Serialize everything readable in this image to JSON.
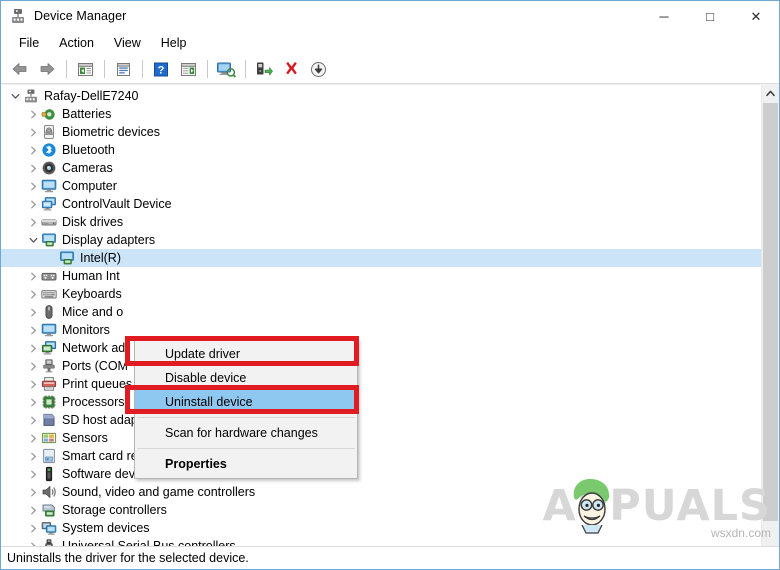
{
  "window": {
    "title": "Device Manager",
    "icon": "device-manager-icon",
    "buttons": {
      "minimize": "─",
      "maximize": "□",
      "close": "✕"
    }
  },
  "menubar": {
    "items": [
      {
        "label": "File",
        "name": "menu-file"
      },
      {
        "label": "Action",
        "name": "menu-action"
      },
      {
        "label": "View",
        "name": "menu-view"
      },
      {
        "label": "Help",
        "name": "menu-help"
      }
    ]
  },
  "toolbar": {
    "buttons": [
      {
        "name": "back-icon",
        "title": "Back"
      },
      {
        "name": "forward-icon",
        "title": "Forward"
      },
      {
        "name": "separator-1",
        "title": ""
      },
      {
        "name": "show-hide-console-tree-icon",
        "title": "Show/Hide Console Tree"
      },
      {
        "name": "separator-2",
        "title": ""
      },
      {
        "name": "properties-icon",
        "title": "Properties"
      },
      {
        "name": "separator-3",
        "title": ""
      },
      {
        "name": "help-icon",
        "title": "Help"
      },
      {
        "name": "show-hide-action-pane-icon",
        "title": "Show/Hide Action Pane"
      },
      {
        "name": "separator-4",
        "title": ""
      },
      {
        "name": "scan-for-hardware-changes-icon",
        "title": "Scan for hardware changes"
      },
      {
        "name": "separator-5",
        "title": ""
      },
      {
        "name": "update-driver-icon",
        "title": "Update driver"
      },
      {
        "name": "uninstall-device-icon",
        "title": "Uninstall device"
      },
      {
        "name": "disable-device-icon",
        "title": "Disable device"
      }
    ]
  },
  "tree": {
    "root": {
      "label": "Rafay-DellE7240",
      "icon": "computer-root-icon",
      "expanded": true
    },
    "nodes": [
      {
        "label": "Batteries",
        "icon": "battery-icon",
        "indent": 1,
        "expanded": false,
        "selected": false
      },
      {
        "label": "Biometric devices",
        "icon": "fingerprint-icon",
        "indent": 1,
        "expanded": false,
        "selected": false
      },
      {
        "label": "Bluetooth",
        "icon": "bluetooth-icon",
        "indent": 1,
        "expanded": false,
        "selected": false
      },
      {
        "label": "Cameras",
        "icon": "camera-icon",
        "indent": 1,
        "expanded": false,
        "selected": false
      },
      {
        "label": "Computer",
        "icon": "monitor-icon",
        "indent": 1,
        "expanded": false,
        "selected": false
      },
      {
        "label": "ControlVault Device",
        "icon": "controlvault-icon",
        "indent": 1,
        "expanded": false,
        "selected": false
      },
      {
        "label": "Disk drives",
        "icon": "disk-drive-icon",
        "indent": 1,
        "expanded": false,
        "selected": false
      },
      {
        "label": "Display adapters",
        "icon": "display-adapter-icon",
        "indent": 1,
        "expanded": true,
        "selected": false
      },
      {
        "label": "Intel(R)",
        "icon": "display-adapter-icon",
        "indent": 2,
        "expanded": null,
        "selected": true
      },
      {
        "label": "Human Int",
        "icon": "hid-icon",
        "indent": 1,
        "expanded": false,
        "selected": false
      },
      {
        "label": "Keyboards",
        "icon": "keyboard-icon",
        "indent": 1,
        "expanded": false,
        "selected": false
      },
      {
        "label": "Mice and o",
        "icon": "mouse-icon",
        "indent": 1,
        "expanded": false,
        "selected": false
      },
      {
        "label": "Monitors",
        "icon": "monitor-icon",
        "indent": 1,
        "expanded": false,
        "selected": false
      },
      {
        "label": "Network ad",
        "icon": "network-adapter-icon",
        "indent": 1,
        "expanded": false,
        "selected": false
      },
      {
        "label": "Ports (COM",
        "icon": "port-icon",
        "indent": 1,
        "expanded": false,
        "selected": false
      },
      {
        "label": "Print queues",
        "icon": "printer-icon",
        "indent": 1,
        "expanded": false,
        "selected": false
      },
      {
        "label": "Processors",
        "icon": "processor-icon",
        "indent": 1,
        "expanded": false,
        "selected": false
      },
      {
        "label": "SD host adapters",
        "icon": "sd-host-icon",
        "indent": 1,
        "expanded": false,
        "selected": false
      },
      {
        "label": "Sensors",
        "icon": "sensor-icon",
        "indent": 1,
        "expanded": false,
        "selected": false
      },
      {
        "label": "Smart card readers",
        "icon": "smartcard-icon",
        "indent": 1,
        "expanded": false,
        "selected": false
      },
      {
        "label": "Software devices",
        "icon": "software-device-icon",
        "indent": 1,
        "expanded": false,
        "selected": false
      },
      {
        "label": "Sound, video and game controllers",
        "icon": "speaker-icon",
        "indent": 1,
        "expanded": false,
        "selected": false
      },
      {
        "label": "Storage controllers",
        "icon": "storage-controller-icon",
        "indent": 1,
        "expanded": false,
        "selected": false
      },
      {
        "label": "System devices",
        "icon": "system-device-icon",
        "indent": 1,
        "expanded": false,
        "selected": false
      },
      {
        "label": "Universal Serial Bus controllers",
        "icon": "usb-icon",
        "indent": 1,
        "expanded": false,
        "selected": false
      }
    ]
  },
  "context_menu": {
    "items": [
      {
        "label": "Update driver",
        "name": "ctx-update-driver",
        "highlight": false,
        "bold": false,
        "separator_before": false
      },
      {
        "label": "Disable device",
        "name": "ctx-disable-device",
        "highlight": false,
        "bold": false,
        "separator_before": false
      },
      {
        "label": "Uninstall device",
        "name": "ctx-uninstall-device",
        "highlight": true,
        "bold": false,
        "separator_before": false
      },
      {
        "label": "Scan for hardware changes",
        "name": "ctx-scan-hardware-changes",
        "highlight": false,
        "bold": false,
        "separator_before": true
      },
      {
        "label": "Properties",
        "name": "ctx-properties",
        "highlight": false,
        "bold": true,
        "separator_before": true
      }
    ]
  },
  "annotations": {
    "color": "#e01b22",
    "boxes": [
      {
        "target": "Update driver",
        "name": "redbox-update-driver"
      },
      {
        "target": "Uninstall device",
        "name": "redbox-uninstall-device"
      }
    ]
  },
  "statusbar": {
    "text": "Uninstalls the driver for the selected device."
  },
  "watermark": {
    "brand": "APPUALS",
    "domain": "wsxdn.com",
    "color": "#d7d7d7"
  },
  "colors": {
    "selection_blue": "#cce4f7",
    "menu_highlight_blue": "#8ec7ef",
    "annotation_red": "#e01b22",
    "window_border": "#6fa8d4",
    "menu_background": "#f2f2f2"
  }
}
